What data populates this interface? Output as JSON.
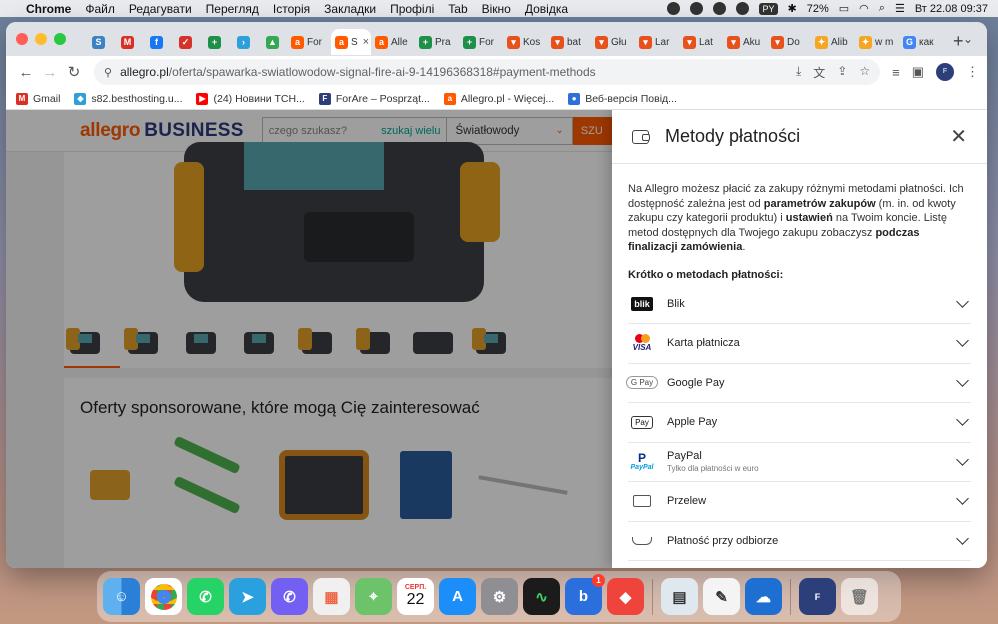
{
  "menubar": {
    "app": "Chrome",
    "items": [
      "Файл",
      "Редагувати",
      "Перегляд",
      "Історія",
      "Закладки",
      "Профілі",
      "Tab",
      "Вікно",
      "Довідка"
    ],
    "lang": "PY",
    "battery": "72%",
    "datetime": "Вт 22.08  09:37"
  },
  "tabs": [
    {
      "icon": "s-icon",
      "color": "#3b82c4",
      "glyph": "S",
      "label": ""
    },
    {
      "icon": "gmail-icon",
      "color": "#d93025",
      "glyph": "M",
      "label": ""
    },
    {
      "icon": "facebook-icon",
      "color": "#1877f2",
      "glyph": "f",
      "label": ""
    },
    {
      "icon": "red-square-icon",
      "color": "#d6312b",
      "glyph": "✓",
      "label": ""
    },
    {
      "icon": "plus-green-icon",
      "color": "#1f8f4a",
      "glyph": "+",
      "label": ""
    },
    {
      "icon": "arrow-icon",
      "color": "#2e9fd8",
      "glyph": "›",
      "label": ""
    },
    {
      "icon": "drive-icon",
      "color": "#34a853",
      "glyph": "▲",
      "label": ""
    },
    {
      "icon": "allegro-icon",
      "color": "#ff5a00",
      "glyph": "a",
      "label": "For"
    },
    {
      "icon": "allegro-icon",
      "color": "#ff5a00",
      "glyph": "a",
      "label": "S",
      "active": true
    },
    {
      "icon": "allegro-icon",
      "color": "#ff5a00",
      "glyph": "a",
      "label": "Alle"
    },
    {
      "icon": "plus-green-icon",
      "color": "#1f8f4a",
      "glyph": "+",
      "label": "Pra"
    },
    {
      "icon": "plus-green-icon",
      "color": "#1f8f4a",
      "glyph": "+",
      "label": "For"
    },
    {
      "icon": "shop-icon",
      "color": "#e8501c",
      "glyph": "▾",
      "label": "Kos"
    },
    {
      "icon": "shop-icon",
      "color": "#e8501c",
      "glyph": "▾",
      "label": "bat"
    },
    {
      "icon": "shop-icon",
      "color": "#e8501c",
      "glyph": "▾",
      "label": "Głu"
    },
    {
      "icon": "shop-icon",
      "color": "#e8501c",
      "glyph": "▾",
      "label": "Lar"
    },
    {
      "icon": "shop-icon",
      "color": "#e8501c",
      "glyph": "▾",
      "label": "Lat"
    },
    {
      "icon": "shop-icon",
      "color": "#e8501c",
      "glyph": "▾",
      "label": "Aku"
    },
    {
      "icon": "shop-icon",
      "color": "#e8501c",
      "glyph": "▾",
      "label": "Do"
    },
    {
      "icon": "aliexpress-icon",
      "color": "#f5a623",
      "glyph": "✦",
      "label": "Alib"
    },
    {
      "icon": "aliexpress-icon",
      "color": "#f5a623",
      "glyph": "✦",
      "label": "w m"
    },
    {
      "icon": "google-icon",
      "color": "#4285f4",
      "glyph": "G",
      "label": "как"
    }
  ],
  "toolbar": {
    "url_host": "allegro.pl",
    "url_path": "/oferta/spawarka-swiatlowodow-signal-fire-ai-9-14196368318#payment-methods"
  },
  "bookmarks": [
    {
      "icon": "gmail-icon",
      "color": "#d93025",
      "glyph": "M",
      "label": "Gmail"
    },
    {
      "icon": "s82-icon",
      "color": "#2e9fd8",
      "glyph": "◆",
      "label": "s82.besthosting.u..."
    },
    {
      "icon": "youtube-icon",
      "color": "#ff0000",
      "glyph": "▶",
      "label": "(24) Новини ТСН..."
    },
    {
      "icon": "forare-icon",
      "color": "#2c3f7a",
      "glyph": "F",
      "label": "ForAre – Posprząt..."
    },
    {
      "icon": "allegro-icon",
      "color": "#ff5a00",
      "glyph": "a",
      "label": "Allegro.pl - Więcej..."
    },
    {
      "icon": "viber-icon",
      "color": "#2f6fd8",
      "glyph": "●",
      "label": "Веб-версія Повід..."
    }
  ],
  "site": {
    "logo_main": "allegro",
    "logo_sub": "BUSINESS",
    "search_placeholder": "czego szukasz?",
    "search_wide": "szukaj wielu",
    "category": "Światłowody",
    "search_button": "SZU"
  },
  "sponsored": {
    "title": "Oferty sponsorowane, które mogą Cię zainteresować"
  },
  "panel": {
    "title": "Metody płatności",
    "intro_1": "Na Allegro możesz płacić za zakupy różnymi metodami płatności. Ich dostępność zależna jest od ",
    "intro_b1": "parametrów zakupów",
    "intro_2": " (m. in. od kwoty zakupu czy kategorii produktu) i ",
    "intro_b2": "ustawień",
    "intro_3": " na Twoim koncie. Listę metod dostępnych dla Twojego zakupu zobaczysz ",
    "intro_b3": "podczas finalizacji zamówienia",
    "intro_4": ".",
    "subhead": "Krótko o metodach płatności:",
    "methods": [
      {
        "label": "Blik",
        "sub": ""
      },
      {
        "label": "Karta płatnicza",
        "sub": ""
      },
      {
        "label": "Google Pay",
        "sub": ""
      },
      {
        "label": "Apple Pay",
        "sub": ""
      },
      {
        "label": "PayPal",
        "sub": "Tylko dla płatności w euro"
      },
      {
        "label": "Przelew",
        "sub": ""
      },
      {
        "label": "Płatność przy odbiorze",
        "sub": ""
      }
    ],
    "icons": {
      "blik": "blik",
      "gpay": "G Pay",
      "apay": " Pay",
      "paypal": "PayPal",
      "visa": "VISA"
    }
  },
  "dock": {
    "calendar_month": "СЕРП.",
    "calendar_day": "22",
    "mail_badge": "1"
  }
}
